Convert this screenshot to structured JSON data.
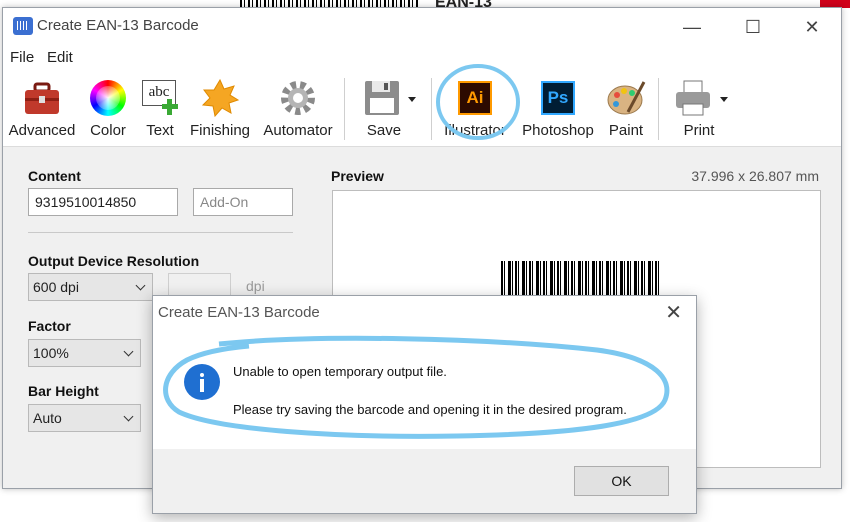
{
  "background": {
    "window_title_fragment": "EAN-13"
  },
  "window": {
    "title": "Create EAN-13 Barcode",
    "controls": {
      "minimize": "—",
      "maximize": "☐",
      "close": "✕"
    }
  },
  "menu": {
    "file": "File",
    "edit": "Edit"
  },
  "toolbar": {
    "advanced": "Advanced",
    "color": "Color",
    "text": "Text",
    "finishing": "Finishing",
    "automator": "Automator",
    "save": "Save",
    "illustrator": "Illustrator",
    "photoshop": "Photoshop",
    "paint": "Paint",
    "print": "Print",
    "illustrator_badge": "Ai",
    "photoshop_badge": "Ps",
    "text_icon_glyph": "abc"
  },
  "form": {
    "content_label": "Content",
    "content_value": "9319510014850",
    "addon_placeholder": "Add-On",
    "resolution_label": "Output Device Resolution",
    "resolution_value": "600 dpi",
    "dpi_unit": "dpi",
    "factor_label": "Factor",
    "factor_value": "100%",
    "bar_height_label": "Bar Height",
    "bar_height_value": "Auto"
  },
  "preview": {
    "label": "Preview",
    "dimensions": "37.996 x 26.807 mm"
  },
  "dialog": {
    "title": "Create EAN-13 Barcode",
    "close": "✕",
    "line1": "Unable to open temporary output file.",
    "line2": "Please try saving the barcode and opening it in the desired program.",
    "ok": "OK"
  },
  "colors": {
    "annotation": "#7cc8f0",
    "illustrator_bg": "#2d0a00",
    "illustrator_fg": "#ff9a00",
    "photoshop_bg": "#001d34",
    "photoshop_fg": "#31a8ff",
    "info_blue": "#1f6fd1"
  }
}
